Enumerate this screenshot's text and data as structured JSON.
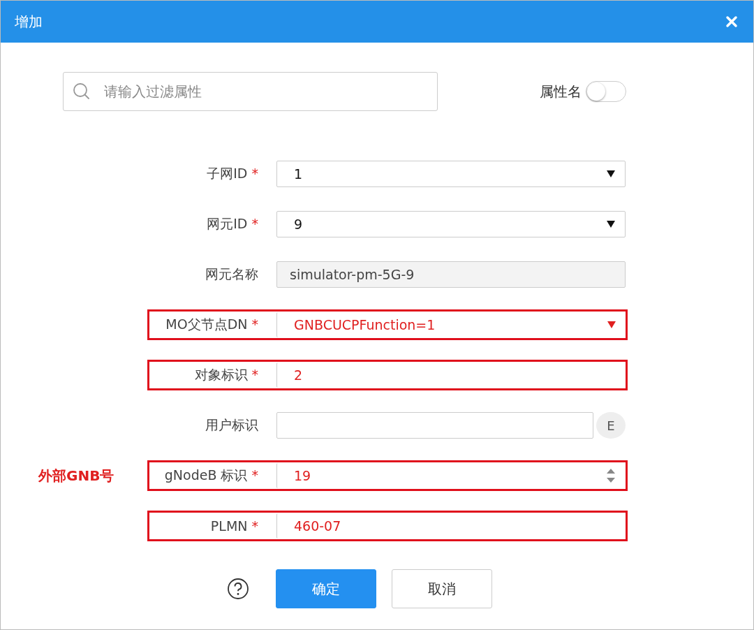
{
  "dialog": {
    "title": "增加"
  },
  "search": {
    "placeholder": "请输入过滤属性"
  },
  "attribute_toggle": {
    "label": "属性名",
    "on": false
  },
  "fields": [
    {
      "kind": "select",
      "label": "子网ID",
      "required_mark": "*",
      "value": "1",
      "highlighted": false
    },
    {
      "kind": "select",
      "label": "网元ID",
      "required_mark": "*",
      "value": "9",
      "highlighted": false
    },
    {
      "kind": "readonly",
      "label": "网元名称",
      "value": "simulator-pm-5G-9",
      "highlighted": false
    },
    {
      "kind": "select",
      "label": "MO父节点DN",
      "required_mark": "*",
      "value": "GNBCUCPFunction=1",
      "highlighted": true
    },
    {
      "kind": "text",
      "label": "对象标识",
      "required_mark": "*",
      "value": "2",
      "highlighted": true
    },
    {
      "kind": "text-button",
      "label": "用户标识",
      "button": "E",
      "highlighted": false
    },
    {
      "kind": "spinner",
      "label": "gNodeB 标识",
      "required_mark": "*",
      "value": "19",
      "highlighted": true,
      "annotation": "外部GNB号"
    },
    {
      "kind": "text",
      "label": "PLMN",
      "required_mark": "*",
      "value": "460-07",
      "highlighted": true
    }
  ],
  "buttons": [
    {
      "label": "确定",
      "primary": true
    },
    {
      "label": "取消",
      "primary": false
    }
  ]
}
